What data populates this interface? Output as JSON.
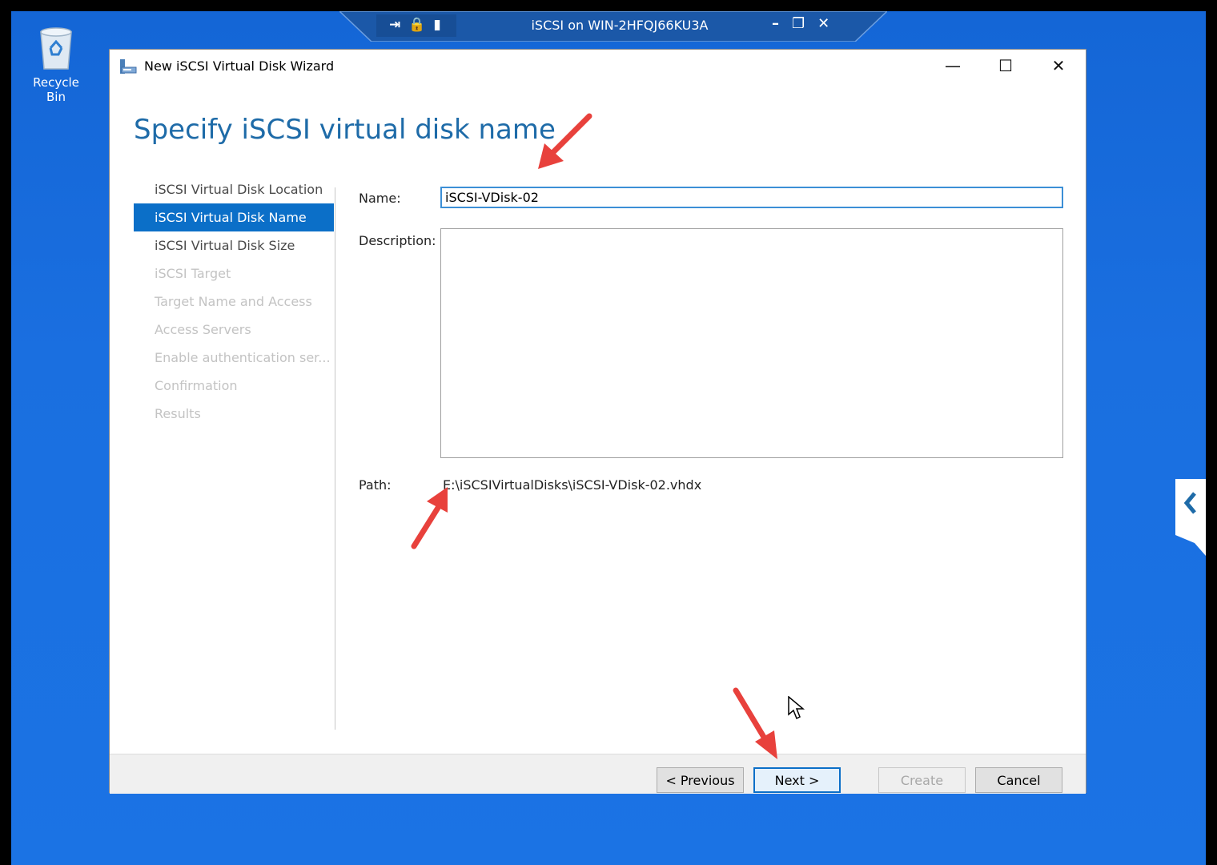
{
  "desktop": {
    "recycle_bin_label": "Recycle Bin"
  },
  "rdp_bar": {
    "title": "iSCSI on WIN-2HFQJ66KU3A"
  },
  "window": {
    "title": "New iSCSI Virtual Disk Wizard",
    "heading": "Specify iSCSI virtual disk name",
    "steps": [
      {
        "label": "iSCSI Virtual Disk Location",
        "state": "done"
      },
      {
        "label": "iSCSI Virtual Disk Name",
        "state": "active"
      },
      {
        "label": "iSCSI Virtual Disk Size",
        "state": "done"
      },
      {
        "label": "iSCSI Target",
        "state": "pending"
      },
      {
        "label": "Target Name and Access",
        "state": "pending"
      },
      {
        "label": "Access Servers",
        "state": "pending"
      },
      {
        "label": "Enable authentication ser...",
        "state": "pending"
      },
      {
        "label": "Confirmation",
        "state": "pending"
      },
      {
        "label": "Results",
        "state": "pending"
      }
    ],
    "form": {
      "name_label": "Name:",
      "name_value": "iSCSI-VDisk-02",
      "description_label": "Description:",
      "description_value": "",
      "path_label": "Path:",
      "path_value": "E:\\iSCSIVirtualDisks\\iSCSI-VDisk-02.vhdx"
    },
    "buttons": {
      "previous": "< Previous",
      "next": "Next >",
      "create": "Create",
      "cancel": "Cancel"
    }
  },
  "colors": {
    "desktop_blue": "#1a6fe0",
    "heading_blue": "#1e6ba8",
    "selection_blue": "#0b6fc8",
    "annotation_red": "#e8413c"
  }
}
